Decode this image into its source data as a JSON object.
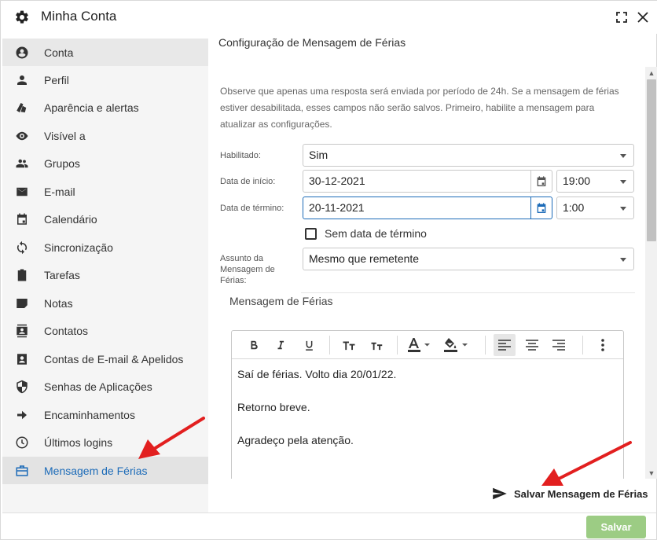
{
  "window": {
    "title": "Minha Conta"
  },
  "sidebar": {
    "items": [
      {
        "label": "Conta",
        "icon": "account-circle-icon"
      },
      {
        "label": "Perfil",
        "icon": "person-icon"
      },
      {
        "label": "Aparência e alertas",
        "icon": "palette-icon"
      },
      {
        "label": "Visível a",
        "icon": "eye-icon"
      },
      {
        "label": "Grupos",
        "icon": "group-icon"
      },
      {
        "label": "E-mail",
        "icon": "envelope-icon"
      },
      {
        "label": "Calendário",
        "icon": "calendar-icon"
      },
      {
        "label": "Sincronização",
        "icon": "sync-icon"
      },
      {
        "label": "Tarefas",
        "icon": "clipboard-check-icon"
      },
      {
        "label": "Notas",
        "icon": "note-icon"
      },
      {
        "label": "Contatos",
        "icon": "contacts-icon"
      },
      {
        "label": "Contas de E-mail & Apelidos",
        "icon": "badge-icon"
      },
      {
        "label": "Senhas de Aplicações",
        "icon": "shield-icon"
      },
      {
        "label": "Encaminhamentos",
        "icon": "arrow-right-icon"
      },
      {
        "label": "Últimos logins",
        "icon": "clock-icon"
      },
      {
        "label": "Mensagem de Férias",
        "icon": "briefcase-icon"
      }
    ]
  },
  "main": {
    "title": "Configuração de Mensagem de Férias",
    "notice": "Observe que apenas uma resposta será enviada por período de 24h. Se a mensagem de férias estiver desabilitada, esses campos não serão salvos. Primeiro, habilite a mensagem para atualizar as configurações.",
    "form": {
      "enabled_label": "Habilitado:",
      "enabled_value": "Sim",
      "start_label": "Data de início:",
      "start_date": "30-12-2021",
      "start_time": "19:00",
      "end_label": "Data de término:",
      "end_date": "20-11-2021",
      "end_time": "1:00",
      "no_end_label": "Sem data de término",
      "subject_label": "Assunto da Mensagem de Férias:",
      "subject_value": "Mesmo que remetente"
    },
    "message_section_title": "Mensagem de Férias",
    "editor_lines": [
      "Saí de férias. Volto dia 20/01/22.",
      "Retorno breve.",
      "Agradeço pela atenção."
    ]
  },
  "footer": {
    "save_vacation_label": "Salvar Mensagem de Férias",
    "save_label": "Salvar"
  },
  "colors": {
    "accent": "#1c6bb8",
    "save_button": "#9ccc84",
    "annotation_arrow": "#e21f1f"
  }
}
